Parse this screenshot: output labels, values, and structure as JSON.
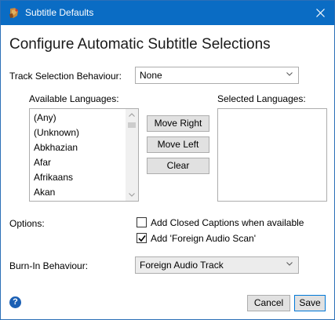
{
  "window": {
    "title": "Subtitle Defaults"
  },
  "heading": "Configure Automatic Subtitle Selections",
  "track_selection": {
    "label": "Track Selection Behaviour:",
    "value": "None"
  },
  "available": {
    "label": "Available Languages:",
    "items": [
      "(Any)",
      "(Unknown)",
      "Abkhazian",
      "Afar",
      "Afrikaans",
      "Akan"
    ]
  },
  "selected": {
    "label": "Selected Languages:"
  },
  "buttons": {
    "move_right": "Move Right",
    "move_left": "Move Left",
    "clear": "Clear",
    "cancel": "Cancel",
    "save": "Save"
  },
  "options": {
    "label": "Options:",
    "closed_captions": {
      "label": "Add Closed Captions when available",
      "checked": false
    },
    "foreign_audio_scan": {
      "label": "Add 'Foreign Audio Scan'",
      "checked": true
    }
  },
  "burn_in": {
    "label": "Burn-In Behaviour:",
    "value": "Foreign Audio Track"
  },
  "help": {
    "glyph": "?"
  },
  "colors": {
    "titlebar": "#0a6cc4",
    "accent": "#0078d7"
  }
}
